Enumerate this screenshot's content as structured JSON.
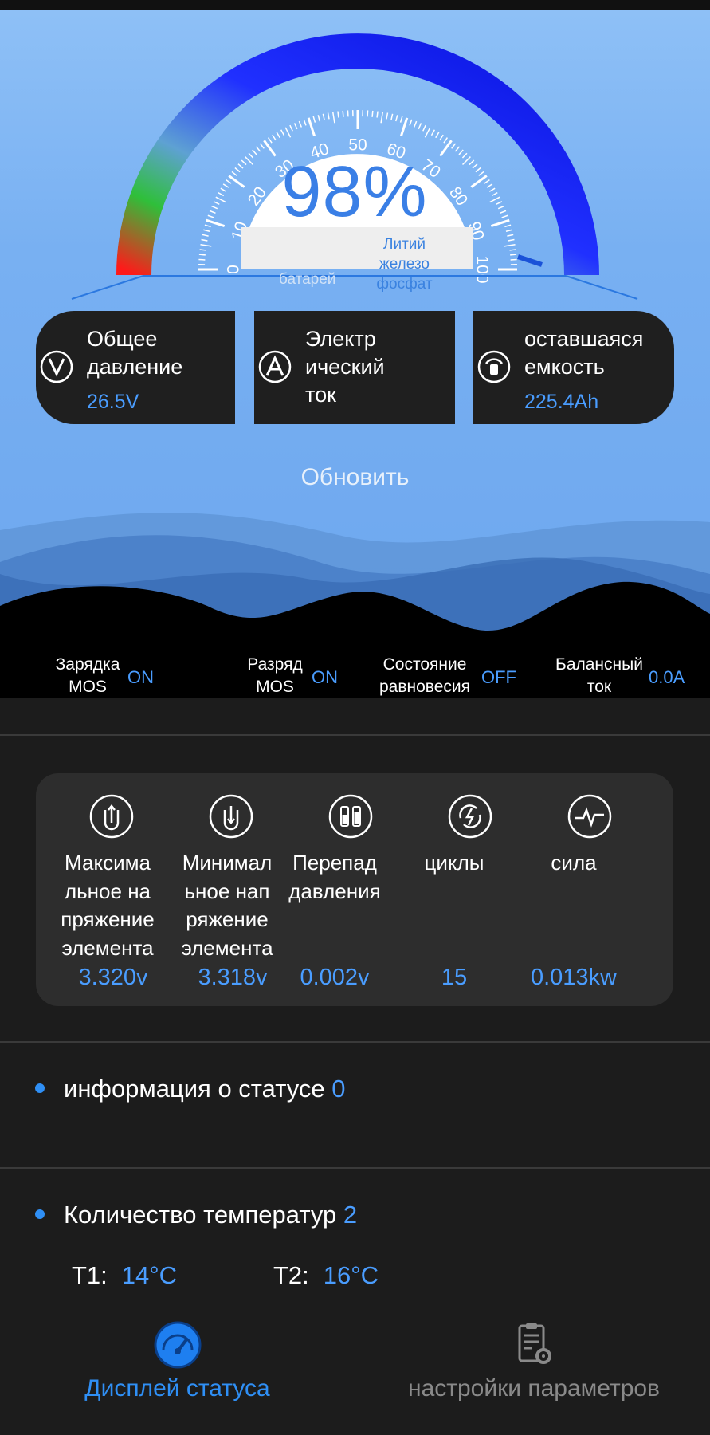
{
  "gauge": {
    "percent": "98%",
    "scale_labels": [
      "0",
      "10",
      "20",
      "30",
      "40",
      "50",
      "60",
      "70",
      "80",
      "90",
      "100"
    ],
    "overlay_text": "батарей",
    "battery_type": "Литий железо фосфат",
    "level_fraction": 0.98
  },
  "info_cards": [
    {
      "label": "Общее давление",
      "value": "26.5V",
      "icon": "v-gauge-icon"
    },
    {
      "label": "Электр ический ток",
      "value": "",
      "icon": "a-gauge-icon"
    },
    {
      "label": "оставшаяся емкость",
      "value": "225.4Ah",
      "icon": "capacity-gauge-icon"
    }
  ],
  "refresh_label": "Обновить",
  "mos_status": [
    {
      "label": "Зарядка MOS",
      "value": "ON"
    },
    {
      "label": "Разряд MOS",
      "value": "ON"
    },
    {
      "label": "Состояние равновесия",
      "value": "OFF"
    },
    {
      "label": "Балансный ток",
      "value": "0.0A"
    }
  ],
  "stats": [
    {
      "label": "Максима льное на пряжение элемента",
      "value": "3.320v",
      "icon": "max-voltage-icon"
    },
    {
      "label": "Минимал ьное нап ряжение элемента",
      "value": "3.318v",
      "icon": "min-voltage-icon"
    },
    {
      "label": "Перепад давления",
      "value": "0.002v",
      "icon": "battery-diff-icon"
    },
    {
      "label": "циклы",
      "value": "15",
      "icon": "cycle-icon"
    },
    {
      "label": "сила",
      "value": "0.013kw",
      "icon": "power-icon"
    }
  ],
  "status_info": {
    "label": "информация о статусе",
    "count": "0"
  },
  "temperature": {
    "label": "Количество температур",
    "count": "2",
    "items": [
      {
        "name": "T1:",
        "value": "14°C"
      },
      {
        "name": "T2:",
        "value": "16°C"
      }
    ]
  },
  "bottom_nav": [
    {
      "label": "Дисплей статуса",
      "active": true,
      "icon": "speedometer-icon"
    },
    {
      "label": "настройки параметров",
      "active": false,
      "icon": "settings-clipboard-icon"
    }
  ],
  "colors": {
    "accent": "#2f8ff5",
    "value_blue": "#4a9dff",
    "gauge_blue": "#0a1be6",
    "card_bg": "#1f1f1f",
    "panel_bg": "#2d2d2d"
  }
}
